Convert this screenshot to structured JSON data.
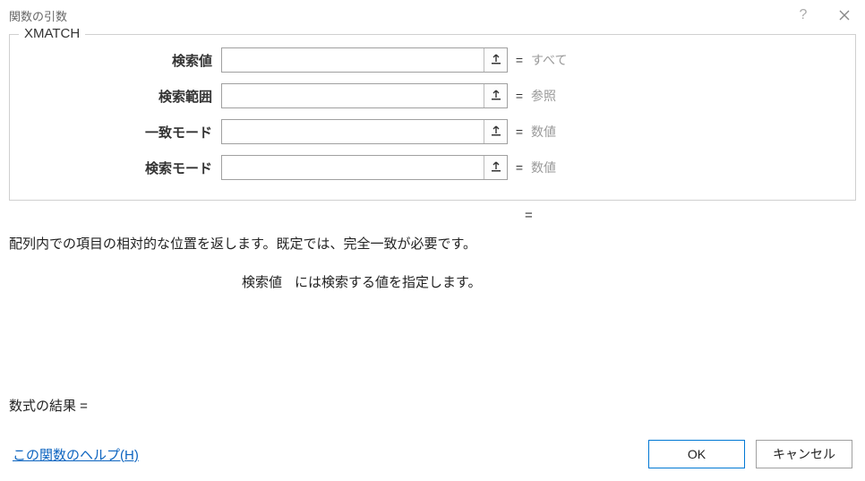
{
  "titlebar": {
    "title": "関数の引数"
  },
  "function_name": "XMATCH",
  "args": [
    {
      "label": "検索値",
      "value": "",
      "hint": "すべて"
    },
    {
      "label": "検索範囲",
      "value": "",
      "hint": "参照"
    },
    {
      "label": "一致モード",
      "value": "",
      "hint": "数値"
    },
    {
      "label": "検索モード",
      "value": "",
      "hint": "数値"
    }
  ],
  "result_eq": "=",
  "description": "配列内での項目の相対的な位置を返します。既定では、完全一致が必要です。",
  "arg_detail": {
    "name": "検索値",
    "text": "には検索する値を指定します。"
  },
  "formula_result_label": "数式の結果 =",
  "help_link": "この関数のヘルプ(H)",
  "buttons": {
    "ok": "OK",
    "cancel": "キャンセル"
  }
}
